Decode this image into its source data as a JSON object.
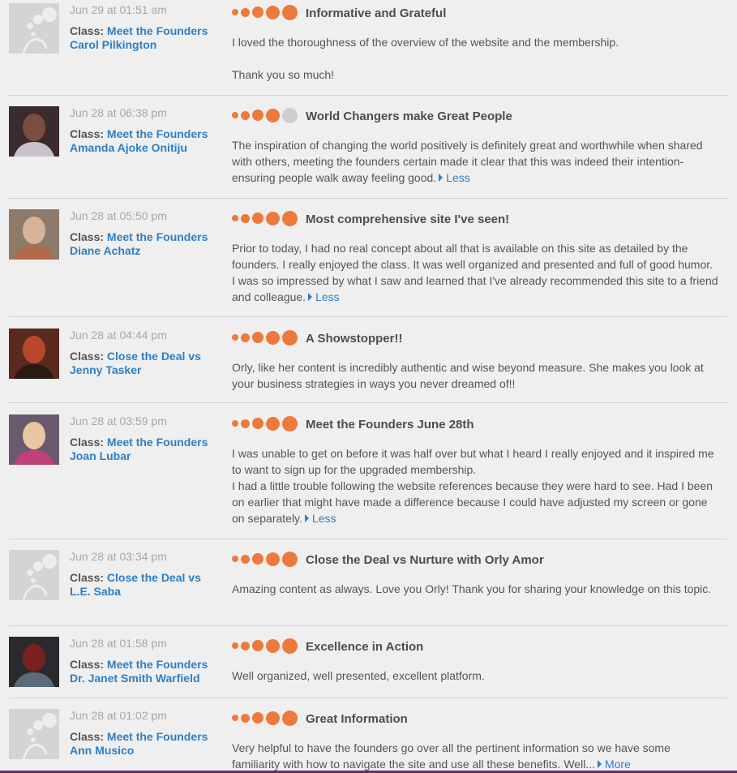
{
  "class_prefix": "Class:",
  "colors": {
    "accent": "#ec7a3d",
    "link": "#2f7fc1",
    "empty_star": "#cfcfcf"
  },
  "reviews": [
    {
      "date": "Jun 29 at 01:51 am",
      "class_name": "Meet the Founders",
      "author": "Carol Pilkington",
      "avatar": "default-avatar-icon",
      "rating": 5,
      "title": "Informative and Grateful",
      "paragraphs": [
        "I loved the thoroughness of the overview of the website and the membership.",
        "Thank you so much!"
      ],
      "toggle": ""
    },
    {
      "date": "Jun 28 at 06:38 pm",
      "class_name": "Meet the Founders",
      "author": "Amanda Ajoke Onitiju",
      "avatar": "user-photo",
      "rating": 4,
      "title": "World Changers make Great People",
      "paragraphs": [
        "The inspiration of changing the world positively is definitely great and worthwhile when shared with others, meeting the founders certain made it clear that this was indeed their intention- ensuring people walk away feeling good."
      ],
      "toggle": "Less"
    },
    {
      "date": "Jun 28 at 05:50 pm",
      "class_name": "Meet the Founders",
      "author": "Diane Achatz",
      "avatar": "user-photo",
      "rating": 5,
      "title": "Most comprehensive site I've seen!",
      "paragraphs": [
        "Prior to today, I had no real concept about all that is available on this site as detailed by the founders. I really enjoyed the class. It was well organized and presented and full of good humor. I was so impressed by what I saw and learned that I've already recommended this site to a friend and colleague."
      ],
      "toggle": "Less"
    },
    {
      "date": "Jun 28 at 04:44 pm",
      "class_name": "Close the Deal vs",
      "author": "Jenny Tasker",
      "avatar": "user-photo",
      "rating": 5,
      "title": "A Showstopper!!",
      "paragraphs": [
        "Orly, like her content is incredibly authentic and wise beyond measure. She makes you look at your business strategies in ways you never dreamed of!!"
      ],
      "toggle": ""
    },
    {
      "date": "Jun 28 at 03:59 pm",
      "class_name": "Meet the Founders",
      "author": "Joan Lubar",
      "avatar": "user-photo",
      "rating": 5,
      "title": "Meet the Founders June 28th",
      "paragraphs": [
        "I was unable to get on before it was half over but what I heard I really enjoyed and it inspired me to want to sign up for the upgraded membership.",
        "I had a little trouble following the website references because they were hard to see. Had I been on earlier that might have made a difference because I could have adjusted my screen or gone on separately."
      ],
      "toggle": "Less"
    },
    {
      "date": "Jun 28 at 03:34 pm",
      "class_name": "Close the Deal vs",
      "author": "L.E. Saba",
      "avatar": "default-avatar-icon",
      "rating": 5,
      "title": "Close the Deal vs Nurture with Orly Amor",
      "paragraphs": [
        "Amazing content as always. Love you Orly! Thank you for sharing your knowledge on this topic."
      ],
      "toggle": ""
    },
    {
      "date": "Jun 28 at 01:58 pm",
      "class_name": "Meet the Founders",
      "author": "Dr. Janet Smith Warfield",
      "avatar": "user-photo",
      "rating": 5,
      "title": "Excellence in Action",
      "paragraphs": [
        "Well organized, well presented, excellent platform."
      ],
      "toggle": ""
    },
    {
      "date": "Jun 28 at 01:02 pm",
      "class_name": "Meet the Founders",
      "author": "Ann Musico",
      "avatar": "default-avatar-icon",
      "rating": 5,
      "title": "Great Information",
      "paragraphs": [
        "Very helpful to have the founders go over all the pertinent information so we have some familiarity with how to navigate the site and use all these benefits. Well..."
      ],
      "toggle": "More"
    }
  ]
}
